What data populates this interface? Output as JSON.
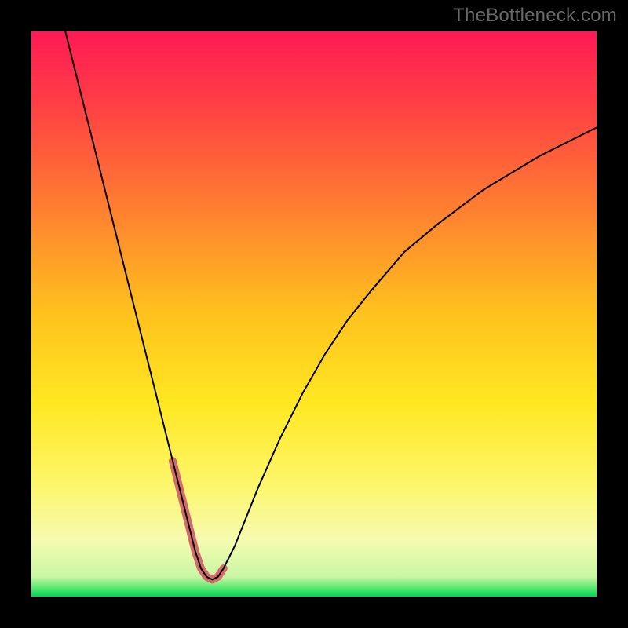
{
  "watermark": "TheBottleneck.com",
  "chart_data": {
    "type": "line",
    "title": "",
    "xlabel": "",
    "ylabel": "",
    "xlim": [
      0,
      100
    ],
    "ylim": [
      0,
      100
    ],
    "background_gradient": {
      "stops": [
        {
          "offset": 0.0,
          "color": "#ff1a55"
        },
        {
          "offset": 0.12,
          "color": "#ff3c46"
        },
        {
          "offset": 0.3,
          "color": "#ff7a32"
        },
        {
          "offset": 0.5,
          "color": "#ffc21e"
        },
        {
          "offset": 0.66,
          "color": "#ffe822"
        },
        {
          "offset": 0.8,
          "color": "#fdf66a"
        },
        {
          "offset": 0.9,
          "color": "#f6fbb0"
        },
        {
          "offset": 0.965,
          "color": "#c8f7a4"
        },
        {
          "offset": 0.985,
          "color": "#57e86e"
        },
        {
          "offset": 1.0,
          "color": "#00d455"
        }
      ]
    },
    "series": [
      {
        "name": "curve",
        "kind": "line",
        "color": "#000000",
        "width": 2,
        "x": [
          6,
          8,
          10,
          12,
          14,
          16,
          18,
          20,
          22,
          24,
          25,
          26,
          27,
          28,
          29,
          30,
          31,
          32,
          33,
          34,
          36,
          38,
          40,
          44,
          48,
          52,
          56,
          60,
          66,
          72,
          80,
          90,
          100
        ],
        "y": [
          100,
          92,
          84,
          76,
          68,
          60,
          52,
          44,
          36,
          28,
          24,
          20,
          16,
          12,
          8,
          5,
          3.5,
          3,
          3.5,
          5,
          9,
          14,
          19,
          28,
          36,
          43,
          49,
          54,
          61,
          66,
          72,
          78,
          83
        ]
      },
      {
        "name": "highlight",
        "kind": "line",
        "color": "#d46a6a",
        "width": 10,
        "linecap": "round",
        "x": [
          25,
          26,
          27,
          28,
          29,
          30,
          31,
          32,
          33,
          34
        ],
        "y": [
          24,
          20,
          16,
          12,
          8,
          5,
          3.5,
          3,
          3.5,
          5
        ]
      }
    ]
  }
}
